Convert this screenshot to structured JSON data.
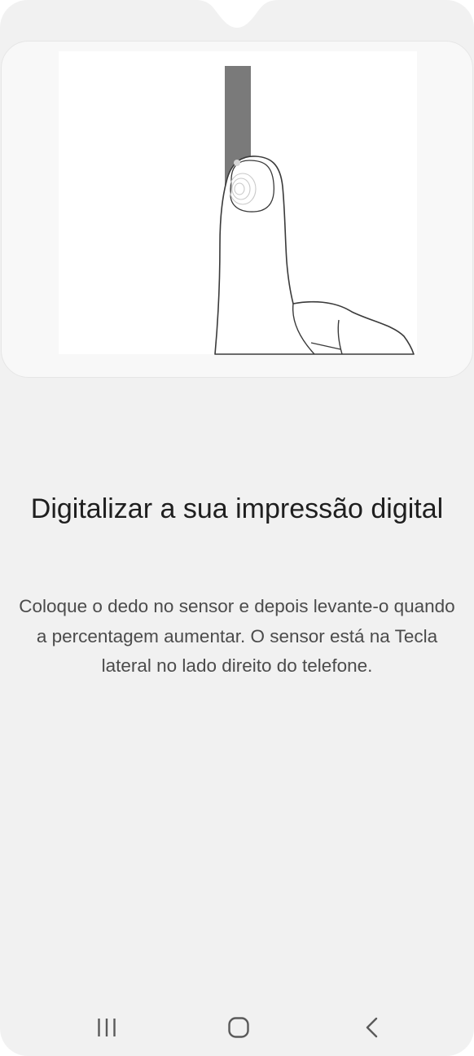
{
  "enrollment": {
    "title": "Digitalizar a sua impressão digital",
    "description": "Coloque o dedo no sensor e depois levante-o quando a percentagem aumentar. O sensor está na Tecla lateral no lado direito do telefone."
  },
  "illustration": {
    "icon": "fingerprint-side-key-icon"
  },
  "navigation_bar": {
    "recent_icon": "recent-apps-icon",
    "home_icon": "home-icon",
    "back_icon": "back-icon"
  },
  "colors": {
    "background": "#f1f1f1",
    "card": "#f8f8f8",
    "side_key": "#7a7a7a",
    "title_text": "#1f1f1f",
    "body_text": "#4b4b4b"
  }
}
